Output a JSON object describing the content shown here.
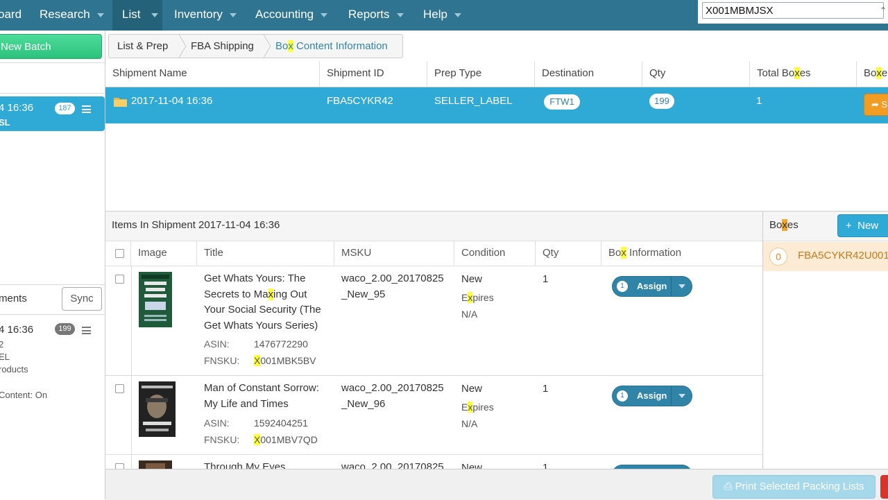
{
  "nav": {
    "items": [
      {
        "label": "oard",
        "caret": false
      },
      {
        "label": "Research",
        "caret": true
      },
      {
        "label": "List",
        "caret": true
      },
      {
        "label": "Inventory",
        "caret": true
      },
      {
        "label": "Accounting",
        "caret": true
      },
      {
        "label": "Reports",
        "caret": true
      },
      {
        "label": "Help",
        "caret": true
      }
    ],
    "search_value": "X001MBMJSX"
  },
  "sidebar": {
    "new_batch_label": "New Batch",
    "active_batch": {
      "time": "4 16:36",
      "sub": "SL",
      "count": "187"
    },
    "shipments_label": "ments",
    "sync_label": "Sync",
    "shipment": {
      "time": "4 16:36",
      "count": "199",
      "line1": "2",
      "line2": "EL",
      "line3": "roducts",
      "line4": " Content: On"
    }
  },
  "breadcrumb": {
    "items": [
      "List & Prep",
      "FBA Shipping"
    ],
    "current_pre": "Bo",
    "current_hl": "x",
    "current_post": " Content Information"
  },
  "shipments_table": {
    "headers": {
      "name": "Shipment Name",
      "id": "Shipment ID",
      "prep": "Prep Type",
      "dest": "Destination",
      "qty": "Qty",
      "total_pre": "Total Bo",
      "total_hl": "x",
      "total_post": "es",
      "boxe_pre": "Bo",
      "boxe_hl": "x",
      "boxe_post": "e"
    },
    "row": {
      "name": "2017-11-04 16:36",
      "id": "FBA5CYKR42",
      "prep": "SELLER_LABEL",
      "dest": "FTW1",
      "qty": "199",
      "total": "1",
      "action_label": "S"
    }
  },
  "items": {
    "title": "Items In Shipment 2017-11-04 16:36",
    "headers": {
      "image": "Image",
      "title": "Title",
      "msku": "MSKU",
      "condition": "Condition",
      "qty": "Qty",
      "box_pre": "Bo",
      "box_hl": "x",
      "box_post": " Information"
    },
    "asin_label": "ASIN:",
    "fnsku_label": "FNSKU:",
    "expires_pre": "E",
    "expires_hl": "x",
    "expires_post": "pires",
    "na": "N/A",
    "rows": [
      {
        "title_pre": "Get Whats Yours: The Secrets to Ma",
        "title_hl": "x",
        "title_post": "ing Out Your Social Security (The Get Whats Yours Series)",
        "asin": "1476772290",
        "fnsku_hl": "X",
        "fnsku_rest": "001MBK5BV",
        "msku": "waco_2.00_20170825_New_95",
        "condition": "New",
        "qty": "1",
        "assign_count": "1",
        "assign_label": "Assign"
      },
      {
        "title": "Man of Constant Sorrow: My Life and Times",
        "asin": "1592404251",
        "fnsku_hl": "X",
        "fnsku_rest": "001MBV7QD",
        "msku": "waco_2.00_20170825_New_96",
        "condition": "New",
        "qty": "1",
        "assign_count": "1",
        "assign_label": "Assign"
      },
      {
        "title": "Through My Eyes",
        "msku": "waco_2.00_20170825",
        "condition": "New",
        "qty": "1"
      }
    ]
  },
  "boxes": {
    "title_pre": "Bo",
    "title_hl": "x",
    "title_post": "es",
    "new_label": "New",
    "box": {
      "count": "0",
      "id": "FBA5CYKR42U001"
    }
  },
  "footer": {
    "print_label": "Print Selected Packing Lists"
  }
}
